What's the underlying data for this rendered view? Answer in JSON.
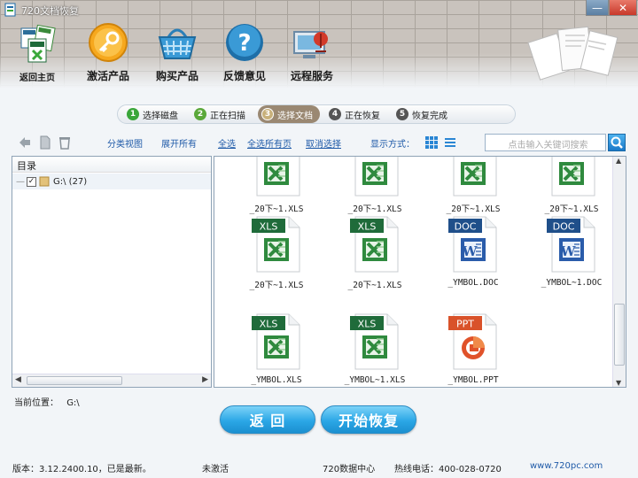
{
  "window": {
    "title": "720文档恢复",
    "min_symbol": "—",
    "close_symbol": "✕"
  },
  "nav": {
    "home_label": "返回主页",
    "items": [
      {
        "label": "激活产品",
        "icon": "key-icon"
      },
      {
        "label": "购买产品",
        "icon": "basket-icon"
      },
      {
        "label": "反馈意见",
        "icon": "help-icon"
      },
      {
        "label": "远程服务",
        "icon": "remote-service-icon"
      }
    ]
  },
  "steps": [
    {
      "num": "1",
      "label": "选择磁盘",
      "color": "#3aa63a"
    },
    {
      "num": "2",
      "label": "正在扫描",
      "color": "#5aa83a"
    },
    {
      "num": "3",
      "label": "选择文档",
      "color": "#b8a070",
      "active": true
    },
    {
      "num": "4",
      "label": "正在恢复",
      "color": "#555555"
    },
    {
      "num": "5",
      "label": "恢复完成",
      "color": "#555555"
    }
  ],
  "toolbar": {
    "category_view": "分类视图",
    "expand_all": "展开所有",
    "select_all": "全选",
    "select_all_pages": "全选所有页",
    "deselect": "取消选择",
    "display_mode": "显示方式：",
    "search_placeholder": "点击输入关键词搜索"
  },
  "tree": {
    "header": "目录",
    "root_label": "G:\\ (27)"
  },
  "files": [
    {
      "name": "_20下~1.XLS",
      "type": "XLS"
    },
    {
      "name": "_20下~1.XLS",
      "type": "XLS"
    },
    {
      "name": "_20下~1.XLS",
      "type": "XLS"
    },
    {
      "name": "_20下~1.XLS",
      "type": "XLS"
    },
    {
      "name": "_20下~1.XLS",
      "type": "XLS"
    },
    {
      "name": "_20下~1.XLS",
      "type": "XLS"
    },
    {
      "name": "_YMBOL.DOC",
      "type": "DOC"
    },
    {
      "name": "_YMBOL~1.DOC",
      "type": "DOC"
    },
    {
      "name": "_YMBOL.XLS",
      "type": "XLS"
    },
    {
      "name": "_YMBOL~1.XLS",
      "type": "XLS"
    },
    {
      "name": "_YMBOL.PPT",
      "type": "PPT"
    }
  ],
  "current_path": {
    "label": "当前位置：",
    "value": "G:\\"
  },
  "buttons": {
    "back": "返 回",
    "start_recover": "开始恢复"
  },
  "status": {
    "version": "版本：3.12.2400.10，已是最新。",
    "activation": "未激活",
    "center": "720数据中心",
    "hotline": "热线电话：400-028-0720",
    "website": "www.720pc.com"
  },
  "colors": {
    "xls": "#1f6b3a",
    "doc": "#1f4f8a",
    "ppt": "#d9522a",
    "link": "#1f5aa8"
  }
}
